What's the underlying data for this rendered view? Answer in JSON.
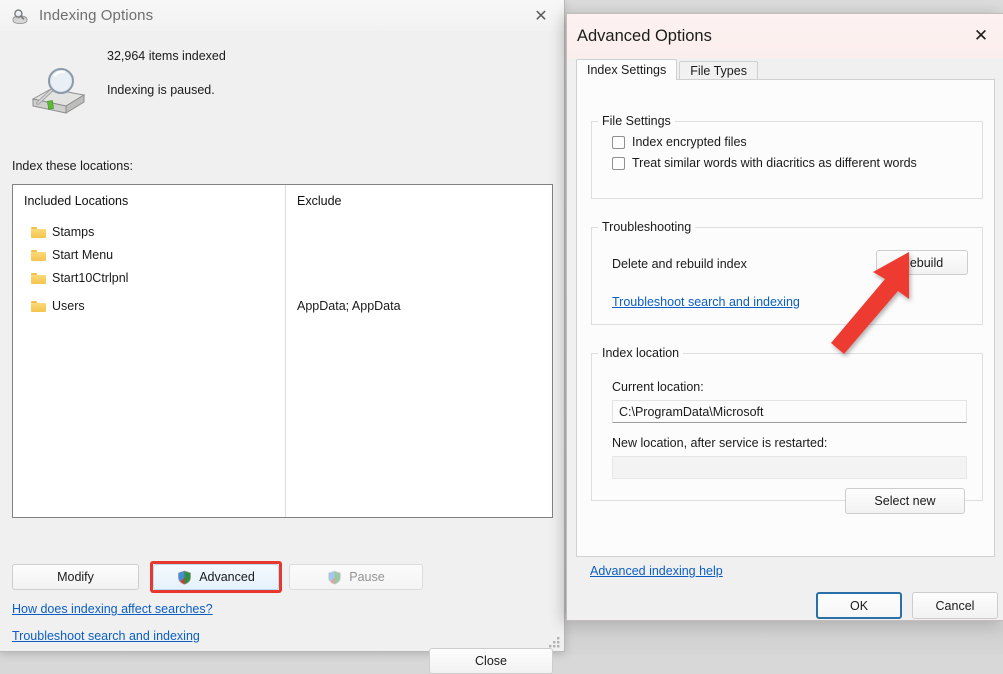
{
  "indexing_window": {
    "title": "Indexing Options",
    "title_icon": "indexing-options-icon",
    "close_glyph": "✕",
    "status": {
      "items_indexed": "32,964 items indexed",
      "state": "Indexing is paused."
    },
    "locations_label": "Index these locations:",
    "list": {
      "columns": [
        "Included Locations",
        "Exclude"
      ],
      "rows": [
        {
          "name": "Stamps",
          "exclude": ""
        },
        {
          "name": "Start Menu",
          "exclude": ""
        },
        {
          "name": "Start10Ctrlpnl",
          "exclude": ""
        },
        {
          "name": "Users",
          "exclude": "AppData; AppData"
        }
      ]
    },
    "buttons": {
      "modify": "Modify",
      "advanced": "Advanced",
      "pause": "Pause",
      "close": "Close"
    },
    "links": {
      "how": "How does indexing affect searches?",
      "troubleshoot": "Troubleshoot search and indexing"
    },
    "highlight_color": "#e8372c"
  },
  "advanced_window": {
    "title": "Advanced Options",
    "close_glyph": "✕",
    "tabs": [
      {
        "label": "Index Settings",
        "active": true
      },
      {
        "label": "File Types",
        "active": false
      }
    ],
    "file_settings": {
      "legend": "File Settings",
      "checkboxes": [
        {
          "label": "Index encrypted files",
          "checked": false
        },
        {
          "label": "Treat similar words with diacritics as different words",
          "checked": false
        }
      ]
    },
    "troubleshooting": {
      "legend": "Troubleshooting",
      "delete_label": "Delete and rebuild index",
      "rebuild_button": "Rebuild",
      "link": "Troubleshoot search and indexing"
    },
    "index_location": {
      "legend": "Index location",
      "current_label": "Current location:",
      "current_value": "C:\\ProgramData\\Microsoft",
      "new_label": "New location, after service is restarted:",
      "new_value": "",
      "select_new_button": "Select new"
    },
    "help_link": "Advanced indexing help",
    "buttons": {
      "ok": "OK",
      "cancel": "Cancel"
    },
    "accent_color": "#2a6fa5"
  },
  "annotation": {
    "arrow_color": "#ee3b33",
    "arrow_points_to": "Rebuild"
  }
}
